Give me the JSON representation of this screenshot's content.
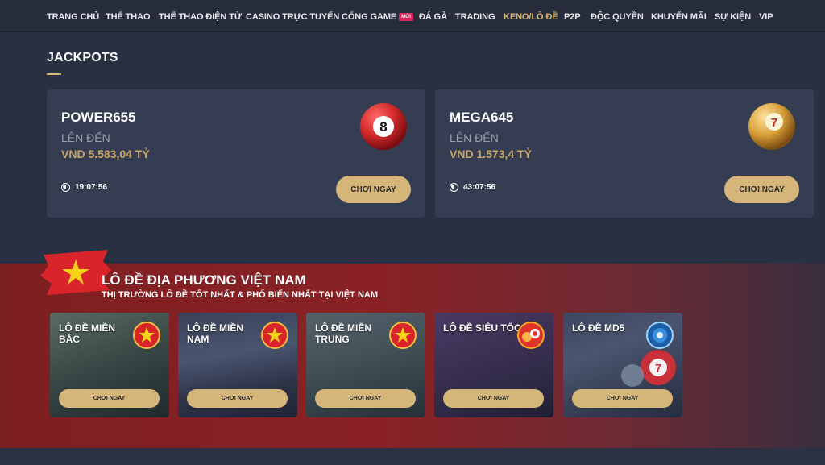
{
  "nav": {
    "items": [
      {
        "label": "TRANG CHỦ"
      },
      {
        "label": "THỂ THAO"
      },
      {
        "label": "THỂ THAO ĐIỆN TỬ"
      },
      {
        "label": "CASINO TRỰC TUYẾN"
      },
      {
        "label": "CỔNG GAME",
        "badge": "MỚI"
      },
      {
        "label": "ĐÁ GÀ"
      },
      {
        "label": "TRADING"
      },
      {
        "label": "KENO/LÔ ĐỀ",
        "active": true
      },
      {
        "label": "P2P"
      },
      {
        "label": "ĐỘC QUYỀN"
      },
      {
        "label": "KHUYẾN MÃI"
      },
      {
        "label": "SỰ KIỆN"
      },
      {
        "label": "VIP"
      }
    ]
  },
  "jackpots": {
    "title": "JACKPOTS",
    "cards": [
      {
        "name": "POWER655",
        "upto": "LÊN ĐẾN",
        "amount": "VND 5.583,04 TỶ",
        "timer": "19:07:56",
        "button": "CHƠI NGAY",
        "ball_number": "8",
        "ball_color": "#d42a2a"
      },
      {
        "name": "MEGA645",
        "upto": "LÊN ĐẾN",
        "amount": "VND 1.573,4 TỶ",
        "timer": "43:07:56",
        "button": "CHƠI NGAY",
        "ball_number": "7",
        "ball_color": "#d9a03a"
      }
    ]
  },
  "lotto": {
    "title": "LÔ ĐỀ ĐỊA PHƯƠNG VIỆT NAM",
    "subtitle": "THỊ TRƯỜNG LÔ ĐỀ TỐT NHẤT & PHỔ BIẾN NHẤT TẠI VIỆT NAM",
    "cards": [
      {
        "name": "LÔ ĐỀ MIỀN BẮC",
        "button": "CHƠI NGAY",
        "icon": "vietnam-flag-icon"
      },
      {
        "name": "LÔ ĐỀ MIỀN NAM",
        "button": "CHƠI NGAY",
        "icon": "vietnam-flag-icon"
      },
      {
        "name": "LÔ ĐỀ MIỀN TRUNG",
        "button": "CHƠI NGAY",
        "icon": "vietnam-flag-icon"
      },
      {
        "name": "LÔ ĐỀ SIÊU TỐC",
        "button": "CHƠI NGAY",
        "icon": "fast-lottery-icon"
      },
      {
        "name": "LÔ ĐỀ MD5",
        "button": "CHƠI NGAY",
        "icon": "md5-icon"
      }
    ]
  },
  "colors": {
    "accent_gold": "#d5b57a",
    "nav_active": "#d7b572",
    "page_bg": "#283042",
    "card_bg": "#353d52",
    "lotto_band": "#7c1f22"
  }
}
